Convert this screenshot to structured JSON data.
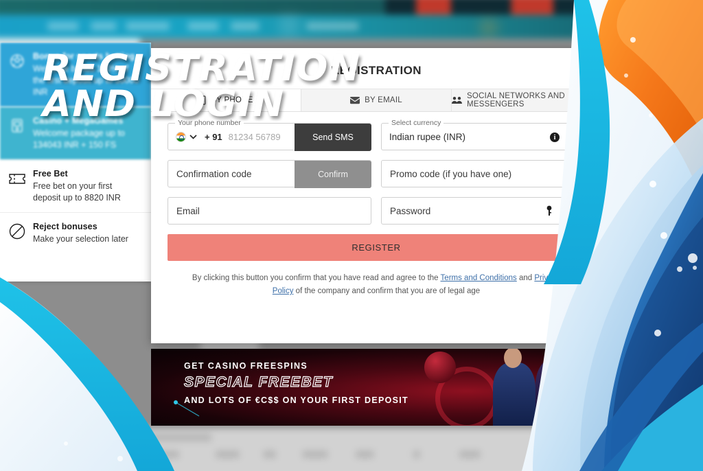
{
  "overlay_headline": {
    "line1": "REGISTRATION",
    "line2": "AND LOGIN"
  },
  "background_site": {
    "nav_items": [
      "Casino",
      "Live Casino",
      "Sports",
      "Aviator",
      "Rocket X",
      "Money Wheel"
    ]
  },
  "bonus_panel": {
    "items": [
      {
        "icon": "football-icon",
        "title": "Bonus for sports betting",
        "subtitle": "Welcome bonus 100% of the first deposit up to 30000 INR",
        "state": "selected-blurred"
      },
      {
        "icon": "slot-machine-icon",
        "title": "Casino + MegaGames",
        "subtitle": "Welcome package up to 134043 INR + 150 FS",
        "state": "selected"
      },
      {
        "icon": "ticket-icon",
        "title": "Free Bet",
        "subtitle": "Free bet on your first deposit up to 8820 INR",
        "state": "plain"
      },
      {
        "icon": "ban-circle-icon",
        "title": "Reject bonuses",
        "subtitle": "Make your selection later",
        "state": "plain"
      }
    ]
  },
  "registration_modal": {
    "title": "REGISTRATION",
    "tabs": [
      {
        "label": "BY PHONE",
        "icon": "phone-icon",
        "active": true
      },
      {
        "label": "BY EMAIL",
        "icon": "envelope-icon",
        "active": false
      },
      {
        "label": "SOCIAL NETWORKS AND MESSENGERS",
        "icon": "people-group-icon",
        "active": false
      }
    ],
    "phone_field": {
      "legend": "Your phone number",
      "country_flag": "india-flag-icon",
      "dial_code": "+ 91",
      "value": "81234 56789",
      "button_label": "Send SMS"
    },
    "currency_field": {
      "legend": "Select currency",
      "value": "Indian rupee (INR)",
      "info_icon": "info-icon",
      "chevron_icon": "chevron-down-icon"
    },
    "confirmation_field": {
      "placeholder": "Confirmation code",
      "button_label": "Confirm"
    },
    "promo_field": {
      "placeholder": "Promo code (if you have one)"
    },
    "email_field": {
      "placeholder": "Email"
    },
    "password_field": {
      "placeholder": "Password",
      "key_icon": "key-icon",
      "eye_icon": "eye-off-icon"
    },
    "register_button": "REGISTER",
    "terms": {
      "text_before": "By clicking this button you confirm that you have read and agree to the ",
      "link_terms": "Terms and Conditions",
      "text_between": " and ",
      "link_privacy": "Privacy Policy",
      "text_after": " of the company and confirm that you are of legal age"
    }
  },
  "promo_banner": {
    "line1": "GET CASINO FREESPINS",
    "line2": "SPECIAL FREEBET",
    "line3": "AND LOTS OF €C$$ ON YOUR FIRST DEPOSIT"
  },
  "colors": {
    "register_button": "#ef8279",
    "selected_bonus_a": "#2fa5d8",
    "selected_bonus_b": "#3fb4cf",
    "nav_teal": "#18a3c2",
    "deco_cyan": "#22b9e0",
    "deco_orange": "#f07818",
    "deco_blue": "#1d63ad"
  }
}
